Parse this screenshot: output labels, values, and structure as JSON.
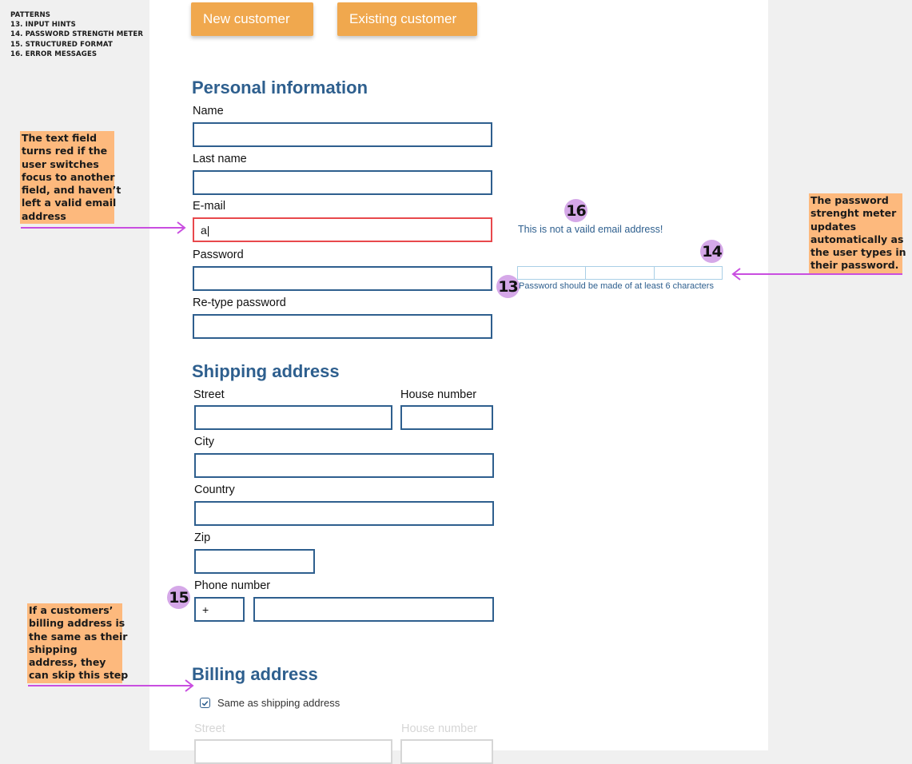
{
  "patterns": {
    "heading": "PATTERNS",
    "items": [
      "13. INPUT HINTS",
      "14. PASSWORD STRENGTH METER",
      "15. STRUCTURED FORMAT",
      "16. ERROR MESSAGES"
    ]
  },
  "tabs": {
    "new_customer": "New customer",
    "existing_customer": "Existing customer"
  },
  "personal": {
    "title": "Personal information",
    "name_label": "Name",
    "last_name_label": "Last name",
    "email_label": "E-mail",
    "email_value": "a|",
    "password_label": "Password",
    "retype_label": "Re-type password"
  },
  "shipping": {
    "title": "Shipping address",
    "street_label": "Street",
    "house_label": "House number",
    "city_label": "City",
    "country_label": "Country",
    "zip_label": "Zip",
    "phone_label": "Phone number",
    "phone_prefix": "+"
  },
  "billing": {
    "title": "Billing address",
    "same_as_label": "Same as shipping address",
    "street_label": "Street",
    "house_label": "House number"
  },
  "messages": {
    "email_error": "This is not a vaild email address!",
    "password_hint": "Password should be made of at least 6 characters"
  },
  "badges": {
    "b13": "13",
    "b14": "14",
    "b15": "15",
    "b16": "16"
  },
  "notes": {
    "email_note": [
      "The text field",
      "turns red if the",
      "user switches",
      "focus to another",
      "field, and haven’t",
      "left a valid email",
      "address"
    ],
    "meter_note": [
      "The password",
      "strenght meter",
      "updates",
      "automatically as",
      "the user types in",
      "their password."
    ],
    "billing_note": [
      "If a customers’",
      "billing address is",
      "the same as their",
      "shipping",
      "address, they",
      "can skip this step"
    ]
  },
  "colors": {
    "accent": "#f0a84e",
    "title": "#2e5f8e",
    "error": "#e8484c",
    "note": "#fdb97d",
    "badge": "#d5a8e8",
    "arrow": "#c94ee0"
  }
}
